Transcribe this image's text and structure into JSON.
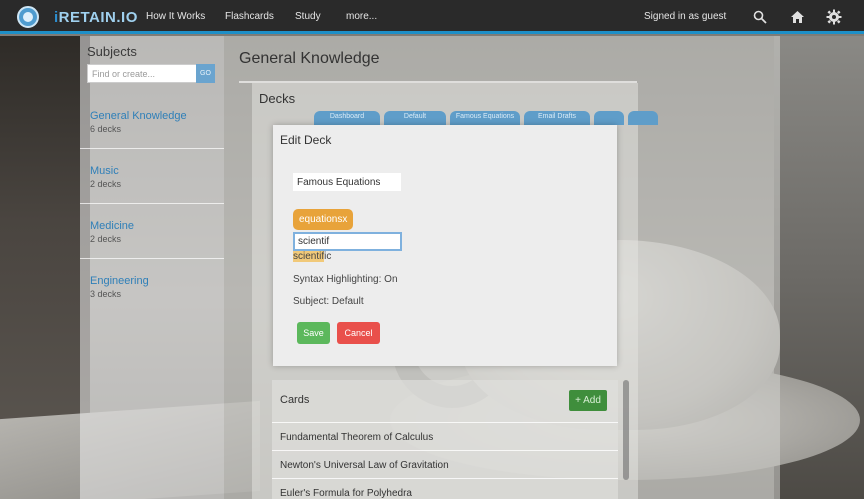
{
  "brand": {
    "prefix": "i",
    "name": "RETAIN.IO"
  },
  "nav": {
    "items": [
      "How It Works",
      "Flashcards",
      "Study",
      "more..."
    ]
  },
  "header": {
    "signed_in": "Signed in as guest"
  },
  "icons": {
    "search": "search-icon",
    "home": "home-icon",
    "settings": "gear-icon"
  },
  "colors": {
    "accent": "#1e8fc7",
    "tag": "#e8a33a",
    "save": "#5cb85c",
    "cancel": "#e9504b",
    "add": "#3f8e3c"
  },
  "sidebar": {
    "title": "Subjects",
    "search_placeholder": "Find or create...",
    "go_label": "GO",
    "subjects": [
      {
        "name": "General Knowledge",
        "count": "6 decks"
      },
      {
        "name": "Music",
        "count": "2 decks"
      },
      {
        "name": "Medicine",
        "count": "2 decks"
      },
      {
        "name": "Engineering",
        "count": "3 decks"
      }
    ]
  },
  "main": {
    "title": "General Knowledge",
    "decks_title": "Decks",
    "tabs": [
      "Dashboard",
      "Default",
      "Famous Equations",
      "Email Drafts",
      "",
      ""
    ],
    "cards_title": "Cards",
    "add_label": "+ Add",
    "cards": [
      "Fundamental Theorem of Calculus",
      "Newton's Universal Law of Gravitation",
      "Euler's Formula for Polyhedra"
    ]
  },
  "modal": {
    "title": "Edit Deck",
    "deck_name": "Famous Equations",
    "tag": "equations",
    "tag_remove": "x",
    "tag_input": "scientif",
    "suggestion_match": "scientif",
    "suggestion_rest": "ic",
    "syntax": "Syntax Highlighting: On",
    "subject": "Subject: Default",
    "save_label": "Save",
    "cancel_label": "Cancel"
  }
}
